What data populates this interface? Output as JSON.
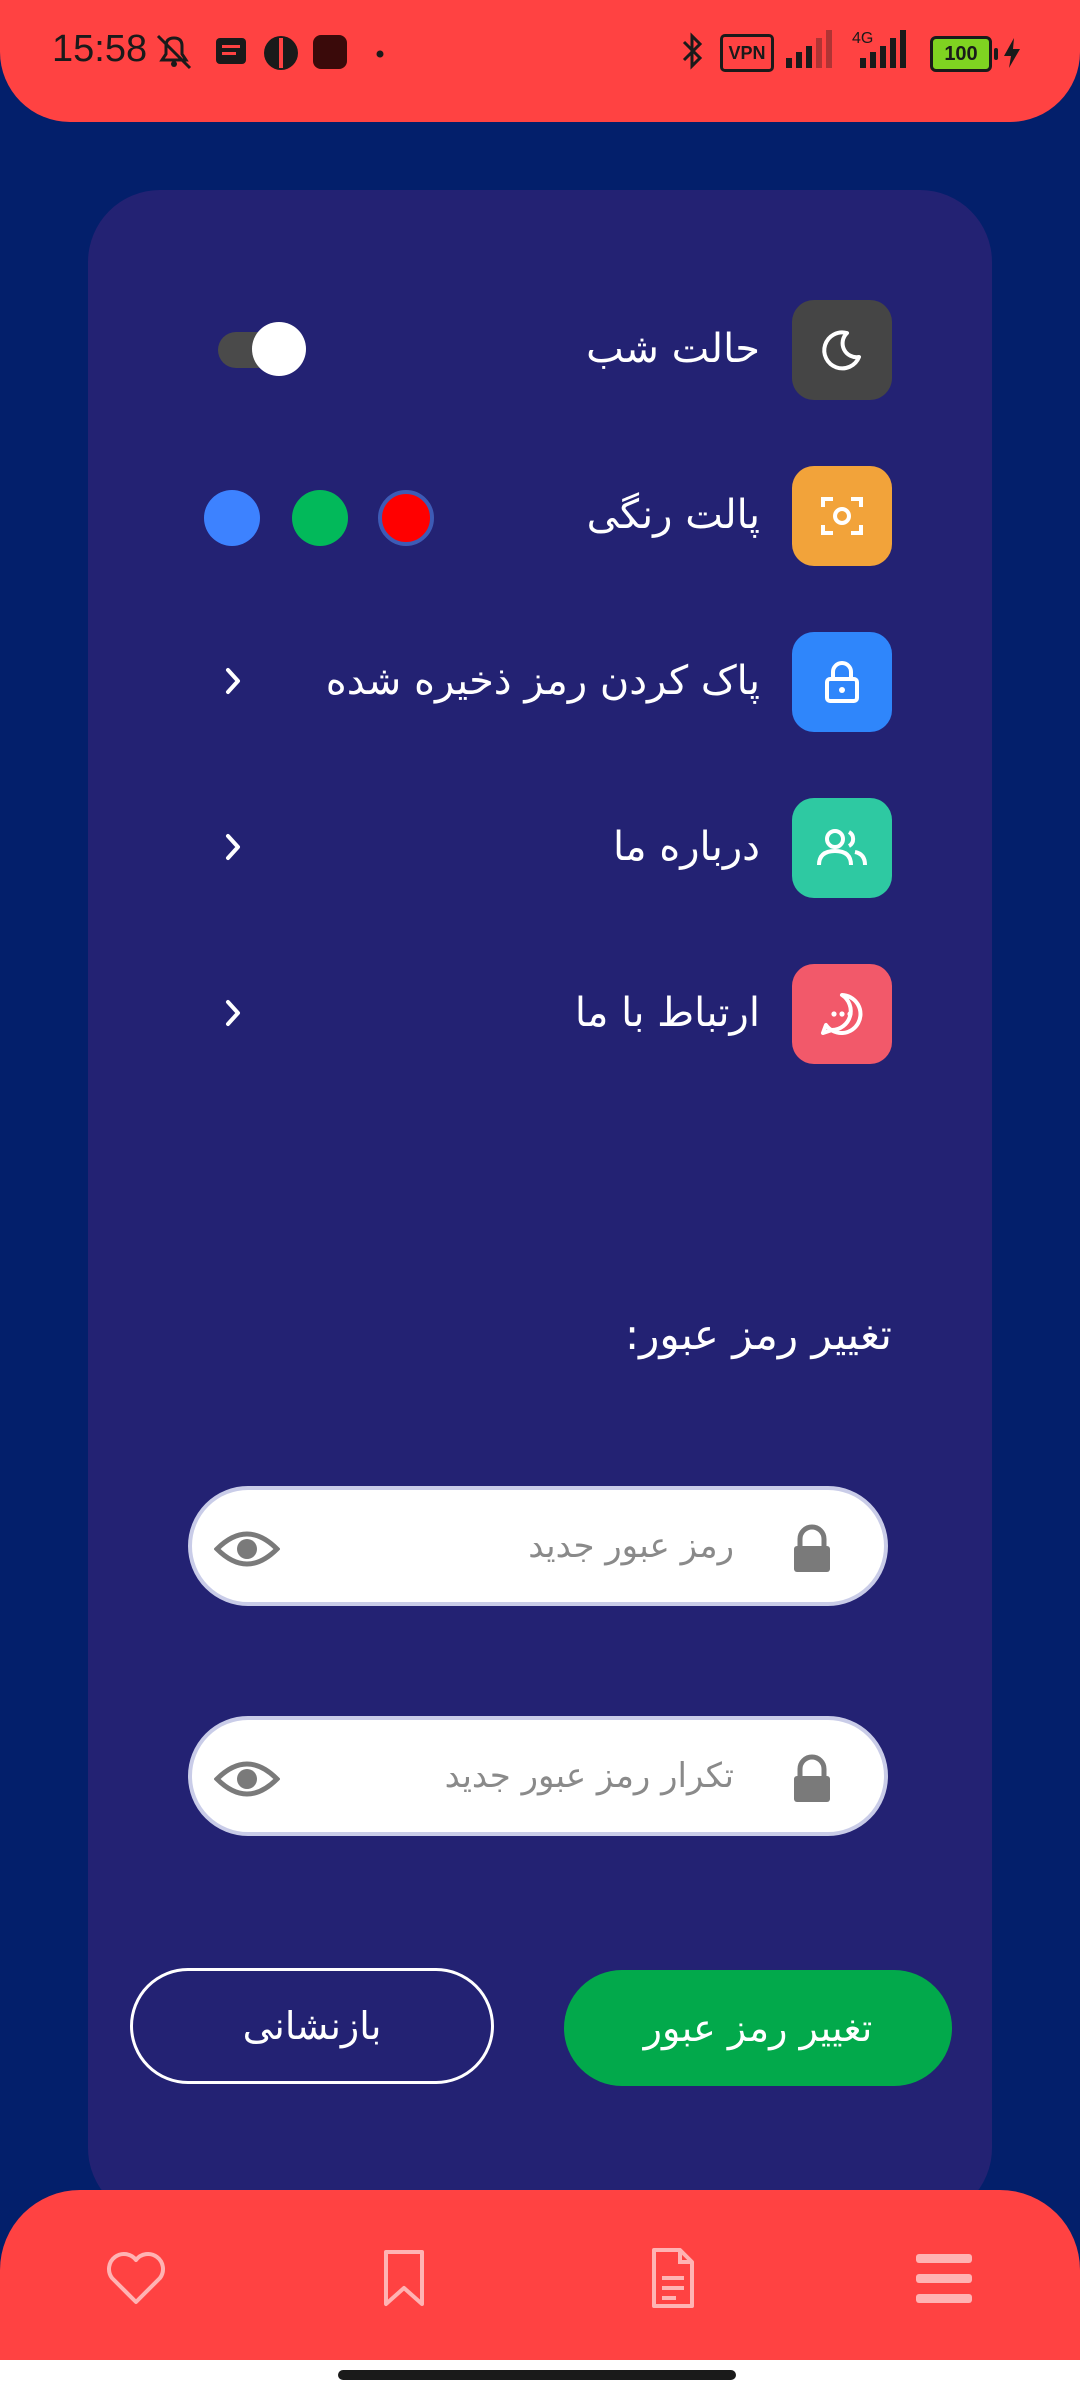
{
  "status_bar": {
    "time": "15:58",
    "vpn": "VPN",
    "network": "4G",
    "battery": "100"
  },
  "settings": {
    "items": [
      {
        "label": "حالت شب",
        "icon": "moon-icon",
        "color": "#454545"
      },
      {
        "label": "پالت رنگی",
        "icon": "palette-icon",
        "color": "#f2a33a"
      },
      {
        "label": "پاک کردن رمز ذخیره شده",
        "icon": "lock-icon",
        "color": "#2f86fb"
      },
      {
        "label": "درباره ما",
        "icon": "users-icon",
        "color": "#2ec9a2"
      },
      {
        "label": "ارتباط با ما",
        "icon": "chat-icon",
        "color": "#f2596a"
      }
    ],
    "dark_mode_enabled": true,
    "palette_colors": [
      "#ff0000",
      "#02b95a",
      "#3d82ff"
    ],
    "selected_palette": "#ff0000"
  },
  "password": {
    "title": "تغییر رمز عبور:",
    "new_placeholder": "رمز عبور جدید",
    "repeat_placeholder": "تکرار رمز عبور جدید",
    "submit_label": "تغییر رمز عبور",
    "reset_label": "بازنشانی"
  },
  "bottom_nav": {
    "items": [
      "heart-icon",
      "bookmark-icon",
      "document-icon",
      "menu-icon"
    ]
  },
  "colors": {
    "background": "#031f6b",
    "card": "#232273",
    "accent": "#ff4242",
    "primary_button": "#02a94b"
  }
}
